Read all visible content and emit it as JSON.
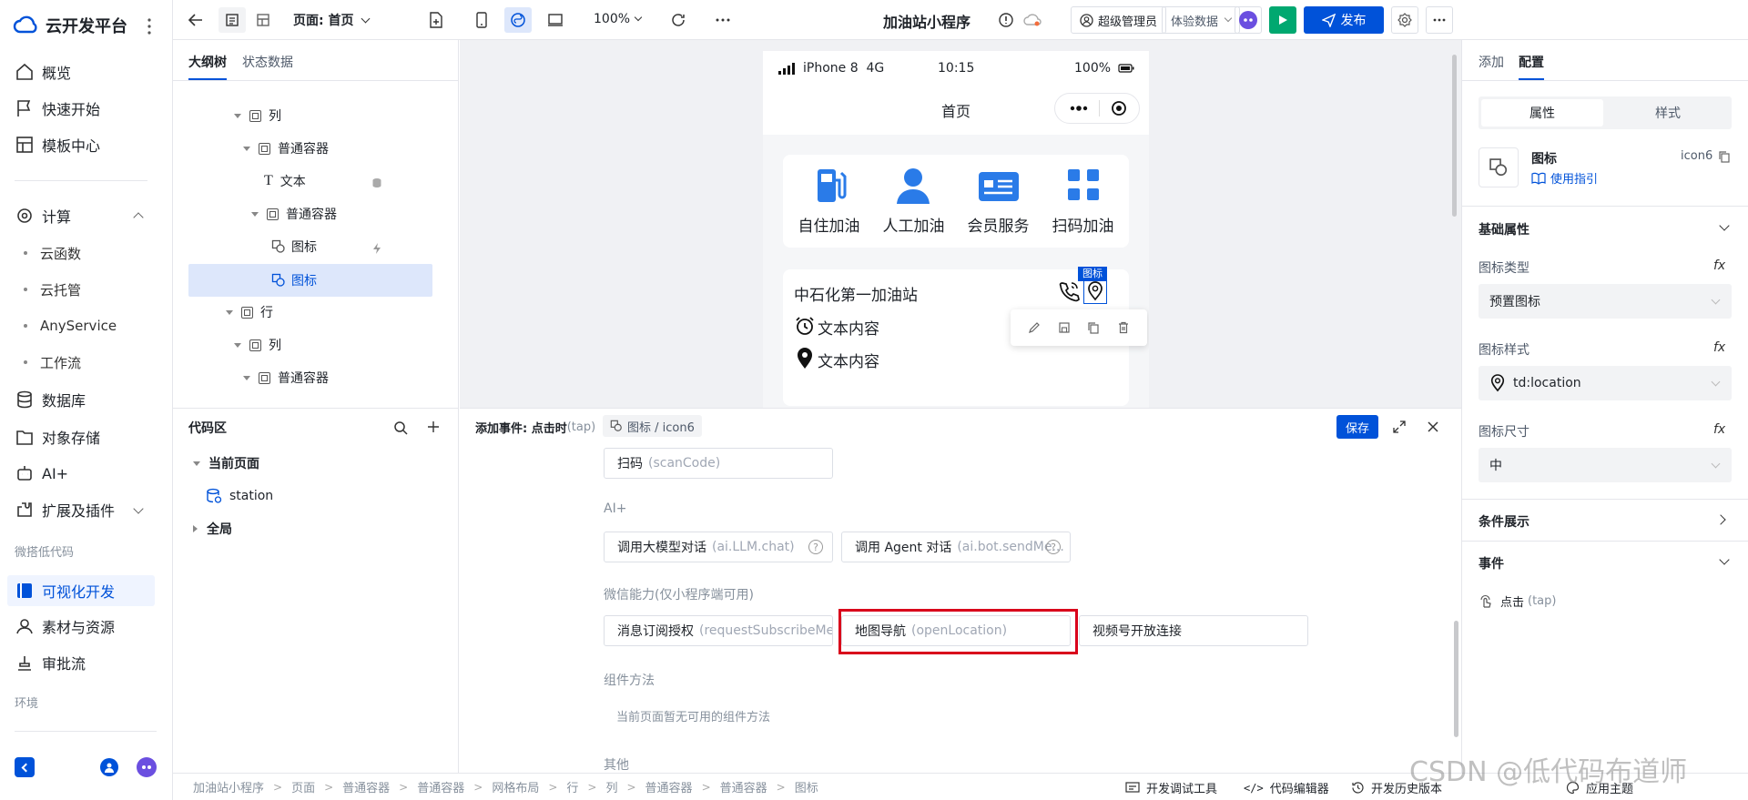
{
  "app": {
    "name": "云开发平台"
  },
  "nav": {
    "items": [
      {
        "label": "概览",
        "icon": "home-icon"
      },
      {
        "label": "快速开始",
        "icon": "flag-icon"
      },
      {
        "label": "模板中心",
        "icon": "template-icon"
      }
    ],
    "compute": {
      "label": "计算",
      "subs": [
        "云函数",
        "云托管",
        "AnyService",
        "工作流"
      ]
    },
    "items2": [
      {
        "label": "数据库",
        "icon": "database-icon"
      },
      {
        "label": "对象存储",
        "icon": "folder-icon"
      },
      {
        "label": "AI+",
        "icon": "robot-icon"
      },
      {
        "label": "扩展及插件",
        "icon": "plugin-icon"
      }
    ],
    "section_lowcode": "微搭低代码",
    "visual_dev": "可视化开发",
    "assets": "素材与资源",
    "approval": "审批流",
    "section_env": "环境"
  },
  "toolbar": {
    "page_label": "页面: 首页",
    "zoom": "100%",
    "app_title": "加油站小程序",
    "user": "超级管理员",
    "data_mode": "体验数据",
    "publish": "发布"
  },
  "outline": {
    "tabs": [
      "大纲树",
      "状态数据"
    ],
    "rows": [
      "列",
      "普通容器",
      "文本",
      "普通容器",
      "图标",
      "图标",
      "行",
      "列",
      "普通容器"
    ]
  },
  "code": {
    "title": "代码区",
    "current_page": "当前页面",
    "station": "station",
    "global": "全局"
  },
  "phone": {
    "carrier": "iPhone 8  4G",
    "time": "10:15",
    "battery": "100%",
    "page_title": "首页",
    "services": [
      "自住加油",
      "人工加油",
      "会员服务",
      "扫码加油"
    ],
    "station_name": "中石化第一加油站",
    "text1": "文本内容",
    "text2": "文本内容",
    "selected_tag": "图标"
  },
  "event": {
    "title": "添加事件: 点击时",
    "title_method": "(tap)",
    "target": "图标 / icon6",
    "save": "保存",
    "scan": {
      "label": "扫码",
      "method": "(scanCode)"
    },
    "ai_group": "AI+",
    "ai_chat": {
      "label": "调用大模型对话",
      "method": "(ai.LLM.chat)"
    },
    "ai_agent": {
      "label": "调用 Agent 对话",
      "method": "(ai.bot.sendMe..."
    },
    "wx_group": "微信能力(仅小程序端可用)",
    "wx_sub": {
      "label": "消息订阅授权",
      "method": "(requestSubscribeMe..."
    },
    "wx_map": {
      "label": "地图导航",
      "method": "(openLocation)"
    },
    "wx_video": {
      "label": "视频号开放连接",
      "method": ""
    },
    "comp_group": "组件方法",
    "comp_empty": "当前页面暂无可用的组件方法",
    "other_group": "其他"
  },
  "right": {
    "tabs": [
      "添加",
      "配置"
    ],
    "subtabs": [
      "属性",
      "样式"
    ],
    "comp_name": "图标",
    "comp_id": "icon6",
    "guide": "使用指引",
    "basic": "基础属性",
    "type_label": "图标类型",
    "type_value": "预置图标",
    "style_label": "图标样式",
    "style_value": "td:location",
    "size_label": "图标尺寸",
    "size_value": "中",
    "cond": "条件展示",
    "events": "事件",
    "tap": "点击",
    "tap_method": "(tap)",
    "fx": "fx"
  },
  "breadcrumb": [
    "加油站小程序",
    "页面",
    "普通容器",
    "普通容器",
    "网格布局",
    "行",
    "列",
    "普通容器",
    "普通容器",
    "图标"
  ],
  "bottom": {
    "debug": "开发调试工具",
    "editor": "代码编辑器",
    "history": "开发历史版本",
    "theme": "应用主题"
  },
  "watermark": "CSDN @低代码布道师",
  "colors": {
    "accent": "#0052d9",
    "publish_green": "#00a870",
    "highlight": "#d9001b"
  }
}
